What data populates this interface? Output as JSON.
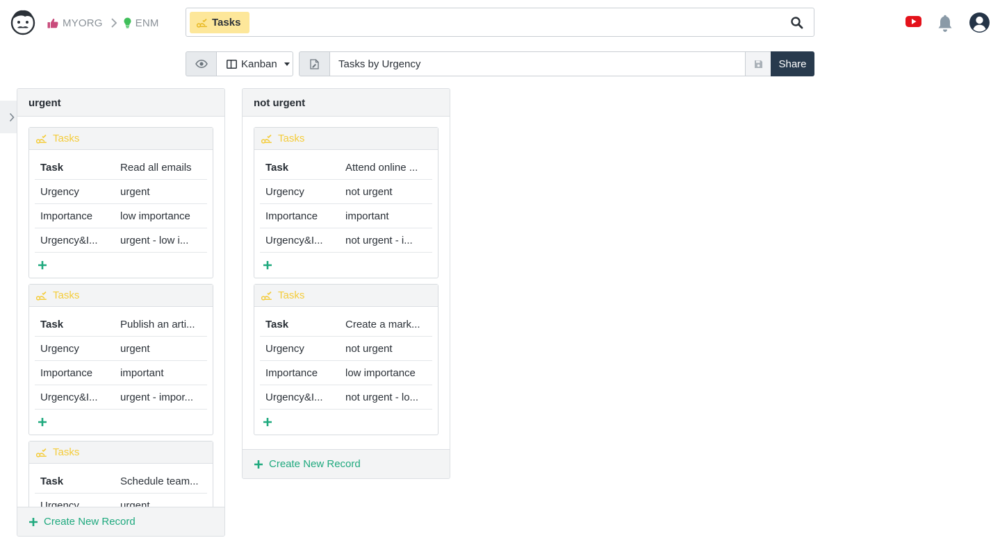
{
  "breadcrumb": {
    "org": "MYORG",
    "env": "ENM"
  },
  "search": {
    "chip_label": "Tasks"
  },
  "toolbar": {
    "view_type": "Kanban",
    "view_name": "Tasks by Urgency",
    "share_label": "Share"
  },
  "colors": {
    "accent_green": "#1fa97e",
    "chip_yellow": "#fde79a",
    "share_dark": "#283a4d",
    "card_title_yellow": "#f4cc3a"
  },
  "columns": [
    {
      "title": "urgent",
      "create_label": "Create New Record",
      "cards": [
        {
          "title": "Tasks",
          "rows": [
            {
              "key": "Task",
              "value": "Read all emails"
            },
            {
              "key": "Urgency",
              "value": "urgent"
            },
            {
              "key": "Importance",
              "value": "low importance"
            },
            {
              "key": "Urgency&I...",
              "value": "urgent - low i..."
            }
          ]
        },
        {
          "title": "Tasks",
          "rows": [
            {
              "key": "Task",
              "value": "Publish an arti..."
            },
            {
              "key": "Urgency",
              "value": "urgent"
            },
            {
              "key": "Importance",
              "value": "important"
            },
            {
              "key": "Urgency&I...",
              "value": "urgent - impor..."
            }
          ]
        },
        {
          "title": "Tasks",
          "rows": [
            {
              "key": "Task",
              "value": "Schedule team..."
            },
            {
              "key": "Urgency",
              "value": "urgent"
            }
          ]
        }
      ]
    },
    {
      "title": "not urgent",
      "create_label": "Create New Record",
      "cards": [
        {
          "title": "Tasks",
          "rows": [
            {
              "key": "Task",
              "value": "Attend online ..."
            },
            {
              "key": "Urgency",
              "value": "not urgent"
            },
            {
              "key": "Importance",
              "value": "important"
            },
            {
              "key": "Urgency&I...",
              "value": "not urgent - i..."
            }
          ]
        },
        {
          "title": "Tasks",
          "rows": [
            {
              "key": "Task",
              "value": "Create a mark..."
            },
            {
              "key": "Urgency",
              "value": "not urgent"
            },
            {
              "key": "Importance",
              "value": "low importance"
            },
            {
              "key": "Urgency&I...",
              "value": "not urgent - lo..."
            }
          ]
        }
      ]
    }
  ]
}
